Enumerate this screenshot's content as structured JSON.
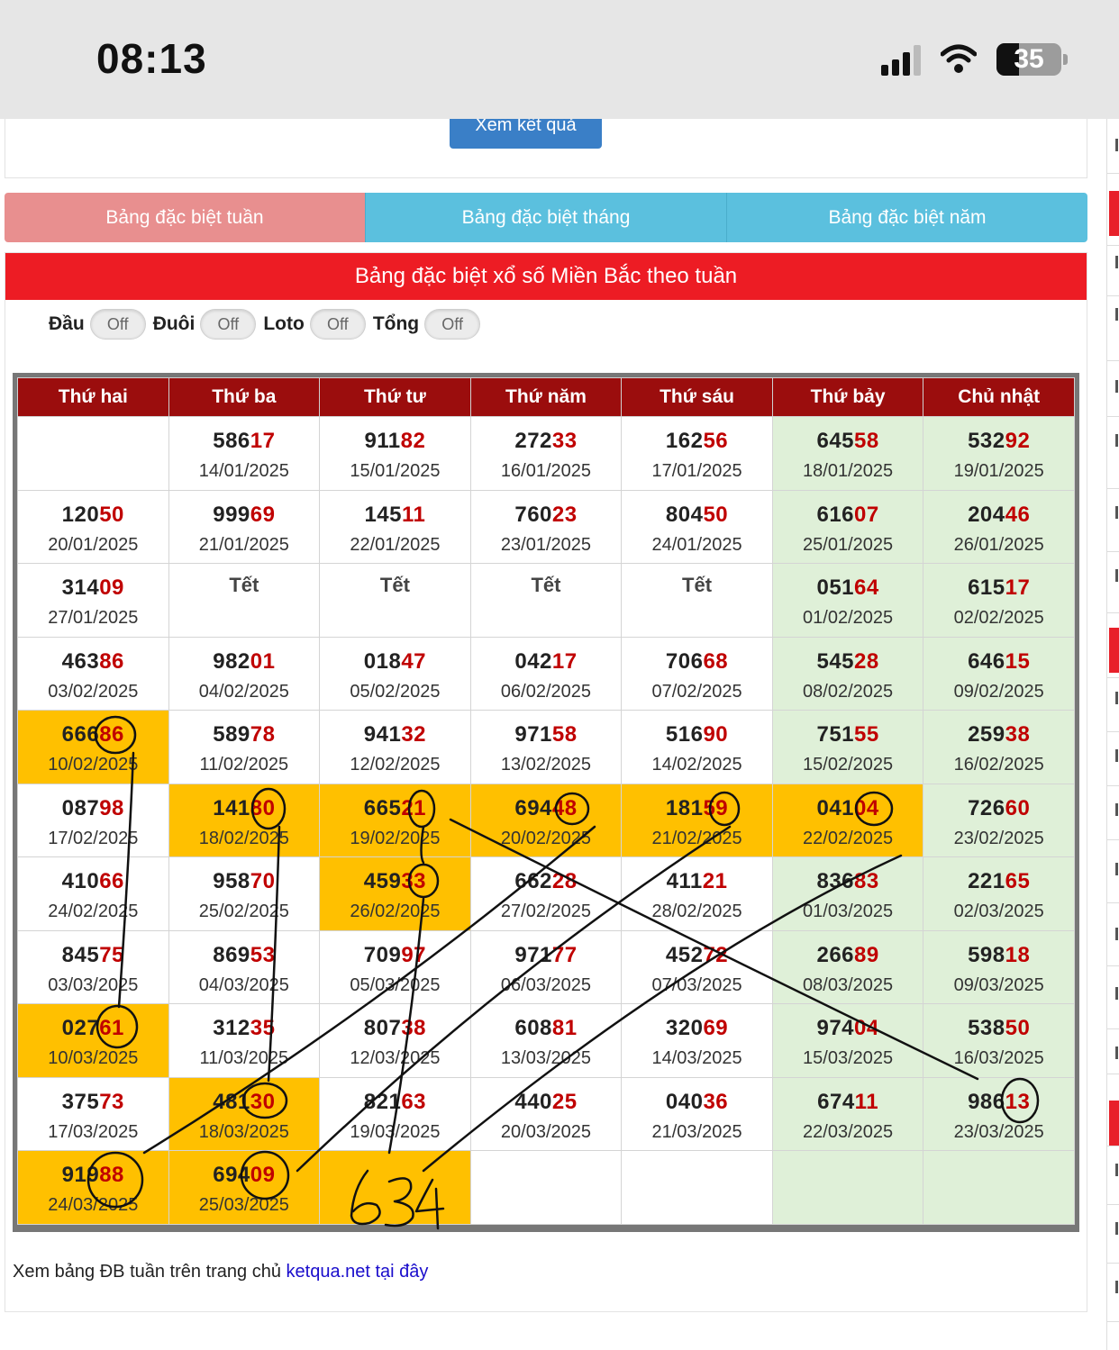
{
  "status": {
    "time": "08:13",
    "battery": "35"
  },
  "top": {
    "view_button": "Xem kết quả"
  },
  "tabs": [
    {
      "label": "Bảng đặc biệt tuần",
      "active": true
    },
    {
      "label": "Bảng đặc biệt tháng",
      "active": false
    },
    {
      "label": "Bảng đặc biệt năm",
      "active": false
    }
  ],
  "panel": {
    "title": "Bảng đặc biệt xổ số Miền Bắc theo tuần",
    "toggles": [
      {
        "label": "Đầu",
        "state": "Off"
      },
      {
        "label": "Đuôi",
        "state": "Off"
      },
      {
        "label": "Loto",
        "state": "Off"
      },
      {
        "label": "Tổng",
        "state": "Off"
      }
    ]
  },
  "table": {
    "headers": [
      "Thứ hai",
      "Thứ ba",
      "Thứ tư",
      "Thứ năm",
      "Thứ sáu",
      "Thứ bảy",
      "Chủ nhật"
    ],
    "rows": [
      [
        null,
        {
          "head": "586",
          "tail": "17",
          "date": "14/01/2025"
        },
        {
          "head": "911",
          "tail": "82",
          "date": "15/01/2025"
        },
        {
          "head": "272",
          "tail": "33",
          "date": "16/01/2025"
        },
        {
          "head": "162",
          "tail": "56",
          "date": "17/01/2025"
        },
        {
          "head": "645",
          "tail": "58",
          "date": "18/01/2025"
        },
        {
          "head": "532",
          "tail": "92",
          "date": "19/01/2025"
        }
      ],
      [
        {
          "head": "120",
          "tail": "50",
          "date": "20/01/2025"
        },
        {
          "head": "999",
          "tail": "69",
          "date": "21/01/2025"
        },
        {
          "head": "145",
          "tail": "11",
          "date": "22/01/2025"
        },
        {
          "head": "760",
          "tail": "23",
          "date": "23/01/2025"
        },
        {
          "head": "804",
          "tail": "50",
          "date": "24/01/2025"
        },
        {
          "head": "616",
          "tail": "07",
          "date": "25/01/2025"
        },
        {
          "head": "204",
          "tail": "46",
          "date": "26/01/2025"
        }
      ],
      [
        {
          "head": "314",
          "tail": "09",
          "date": "27/01/2025"
        },
        {
          "note": "Tết"
        },
        {
          "note": "Tết"
        },
        {
          "note": "Tết"
        },
        {
          "note": "Tết"
        },
        {
          "head": "051",
          "tail": "64",
          "date": "01/02/2025"
        },
        {
          "head": "615",
          "tail": "17",
          "date": "02/02/2025"
        }
      ],
      [
        {
          "head": "463",
          "tail": "86",
          "date": "03/02/2025"
        },
        {
          "head": "982",
          "tail": "01",
          "date": "04/02/2025"
        },
        {
          "head": "018",
          "tail": "47",
          "date": "05/02/2025"
        },
        {
          "head": "042",
          "tail": "17",
          "date": "06/02/2025"
        },
        {
          "head": "706",
          "tail": "68",
          "date": "07/02/2025"
        },
        {
          "head": "545",
          "tail": "28",
          "date": "08/02/2025"
        },
        {
          "head": "646",
          "tail": "15",
          "date": "09/02/2025"
        }
      ],
      [
        {
          "head": "666",
          "tail": "86",
          "date": "10/02/2025",
          "hl": true
        },
        {
          "head": "589",
          "tail": "78",
          "date": "11/02/2025"
        },
        {
          "head": "941",
          "tail": "32",
          "date": "12/02/2025"
        },
        {
          "head": "971",
          "tail": "58",
          "date": "13/02/2025"
        },
        {
          "head": "516",
          "tail": "90",
          "date": "14/02/2025"
        },
        {
          "head": "751",
          "tail": "55",
          "date": "15/02/2025"
        },
        {
          "head": "259",
          "tail": "38",
          "date": "16/02/2025"
        }
      ],
      [
        {
          "head": "087",
          "tail": "98",
          "date": "17/02/2025"
        },
        {
          "head": "141",
          "tail": "80",
          "date": "18/02/2025",
          "hl": true
        },
        {
          "head": "665",
          "tail": "21",
          "date": "19/02/2025",
          "hl": true
        },
        {
          "head": "694",
          "tail": "48",
          "date": "20/02/2025",
          "hl": true
        },
        {
          "head": "181",
          "tail": "59",
          "date": "21/02/2025",
          "hl": true
        },
        {
          "head": "041",
          "tail": "04",
          "date": "22/02/2025",
          "hl": true
        },
        {
          "head": "726",
          "tail": "60",
          "date": "23/02/2025"
        }
      ],
      [
        {
          "head": "410",
          "tail": "66",
          "date": "24/02/2025"
        },
        {
          "head": "958",
          "tail": "70",
          "date": "25/02/2025"
        },
        {
          "head": "459",
          "tail": "33",
          "date": "26/02/2025",
          "hl": true
        },
        {
          "head": "662",
          "tail": "28",
          "date": "27/02/2025"
        },
        {
          "head": "411",
          "tail": "21",
          "date": "28/02/2025"
        },
        {
          "head": "836",
          "tail": "83",
          "date": "01/03/2025"
        },
        {
          "head": "221",
          "tail": "65",
          "date": "02/03/2025"
        }
      ],
      [
        {
          "head": "845",
          "tail": "75",
          "date": "03/03/2025"
        },
        {
          "head": "869",
          "tail": "53",
          "date": "04/03/2025"
        },
        {
          "head": "709",
          "tail": "97",
          "date": "05/03/2025"
        },
        {
          "head": "971",
          "tail": "77",
          "date": "06/03/2025"
        },
        {
          "head": "452",
          "tail": "72",
          "date": "07/03/2025"
        },
        {
          "head": "266",
          "tail": "89",
          "date": "08/03/2025"
        },
        {
          "head": "598",
          "tail": "18",
          "date": "09/03/2025"
        }
      ],
      [
        {
          "head": "027",
          "tail": "61",
          "date": "10/03/2025",
          "hl": true
        },
        {
          "head": "312",
          "tail": "35",
          "date": "11/03/2025"
        },
        {
          "head": "807",
          "tail": "38",
          "date": "12/03/2025"
        },
        {
          "head": "608",
          "tail": "81",
          "date": "13/03/2025"
        },
        {
          "head": "320",
          "tail": "69",
          "date": "14/03/2025"
        },
        {
          "head": "974",
          "tail": "04",
          "date": "15/03/2025"
        },
        {
          "head": "538",
          "tail": "50",
          "date": "16/03/2025"
        }
      ],
      [
        {
          "head": "375",
          "tail": "73",
          "date": "17/03/2025"
        },
        {
          "head": "481",
          "tail": "30",
          "date": "18/03/2025",
          "hl": true
        },
        {
          "head": "821",
          "tail": "63",
          "date": "19/03/2025"
        },
        {
          "head": "440",
          "tail": "25",
          "date": "20/03/2025"
        },
        {
          "head": "040",
          "tail": "36",
          "date": "21/03/2025"
        },
        {
          "head": "674",
          "tail": "11",
          "date": "22/03/2025"
        },
        {
          "head": "986",
          "tail": "13",
          "date": "23/03/2025"
        }
      ],
      [
        {
          "head": "919",
          "tail": "88",
          "date": "24/03/2025",
          "hl": true
        },
        {
          "head": "694",
          "tail": "09",
          "date": "25/03/2025",
          "hl": true
        },
        {
          "hl": true,
          "empty": true
        },
        {
          "empty": true
        },
        {
          "empty": true
        },
        {
          "empty": true
        },
        {
          "empty": true
        }
      ]
    ]
  },
  "handwriting": {
    "text": "634"
  },
  "footer": {
    "text": "Xem bảng ĐB tuần trên trang chủ ",
    "link": "ketqua.net tại đây"
  },
  "colors": {
    "header_red": "#ed1c24",
    "table_head": "#9b0d0d",
    "highlight": "#ffc000",
    "weekend": "#dff0d8",
    "tab_active": "#e88f8f",
    "tab_inactive": "#5bc0de",
    "link": "#1a0dcc"
  }
}
